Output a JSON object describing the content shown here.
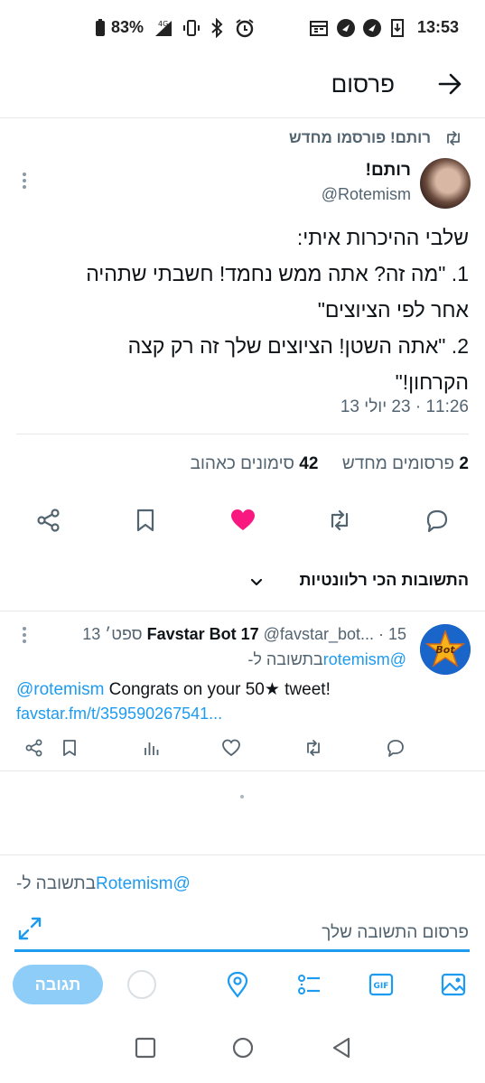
{
  "status_bar": {
    "battery": "83%",
    "time": "13:53",
    "icons": [
      "battery-icon",
      "signal-4g-icon",
      "vibrate-icon",
      "bluetooth-icon",
      "alarm-icon",
      "calendar-icon",
      "app-icon",
      "app-icon",
      "download-icon"
    ]
  },
  "header": {
    "title": "פרסום"
  },
  "tweet": {
    "retweeted_by": "רותם! פורסמו מחדש",
    "author_name": "רותם!",
    "author_handle": "@Rotemism",
    "lines": [
      "שלבי ההיכרות איתי:",
      "1. \"מה זה? אתה ממש נחמד! חשבתי שתהיה",
      "אחר לפי הציוצים\"",
      "2. \"אתה השטן! הציוצים שלך זה רק קצה",
      "הקרחון!\""
    ],
    "time": "11:26 · 23 יולי 13",
    "retweets_count": "2",
    "retweets_label": "פרסומים מחדש",
    "likes_count": "42",
    "likes_label": "סימונים כאהוב"
  },
  "colors": {
    "accent": "#1d9bf0",
    "like": "#f91880",
    "secondary_text": "#536471"
  },
  "relevant_replies": {
    "label": "התשובות הכי רלוונטיות"
  },
  "reply": {
    "name": "Favstar Bot 17",
    "meta": "@favstar_bot... · 15 ספט׳ 13",
    "reply_to_prefix": "בתשובה ל-",
    "reply_to_handle": "@rotemism",
    "text_mention": "@rotemism",
    "text_rest": " Congrats on your 50★ tweet!",
    "link": "favstar.fm/t/359590267541...",
    "avatar_text": "Bot"
  },
  "composer": {
    "context_prefix": "בתשובה ל-",
    "context_handle": "@Rotemism",
    "placeholder": "פרסום התשובה שלך",
    "reply_button": "תגובה"
  }
}
